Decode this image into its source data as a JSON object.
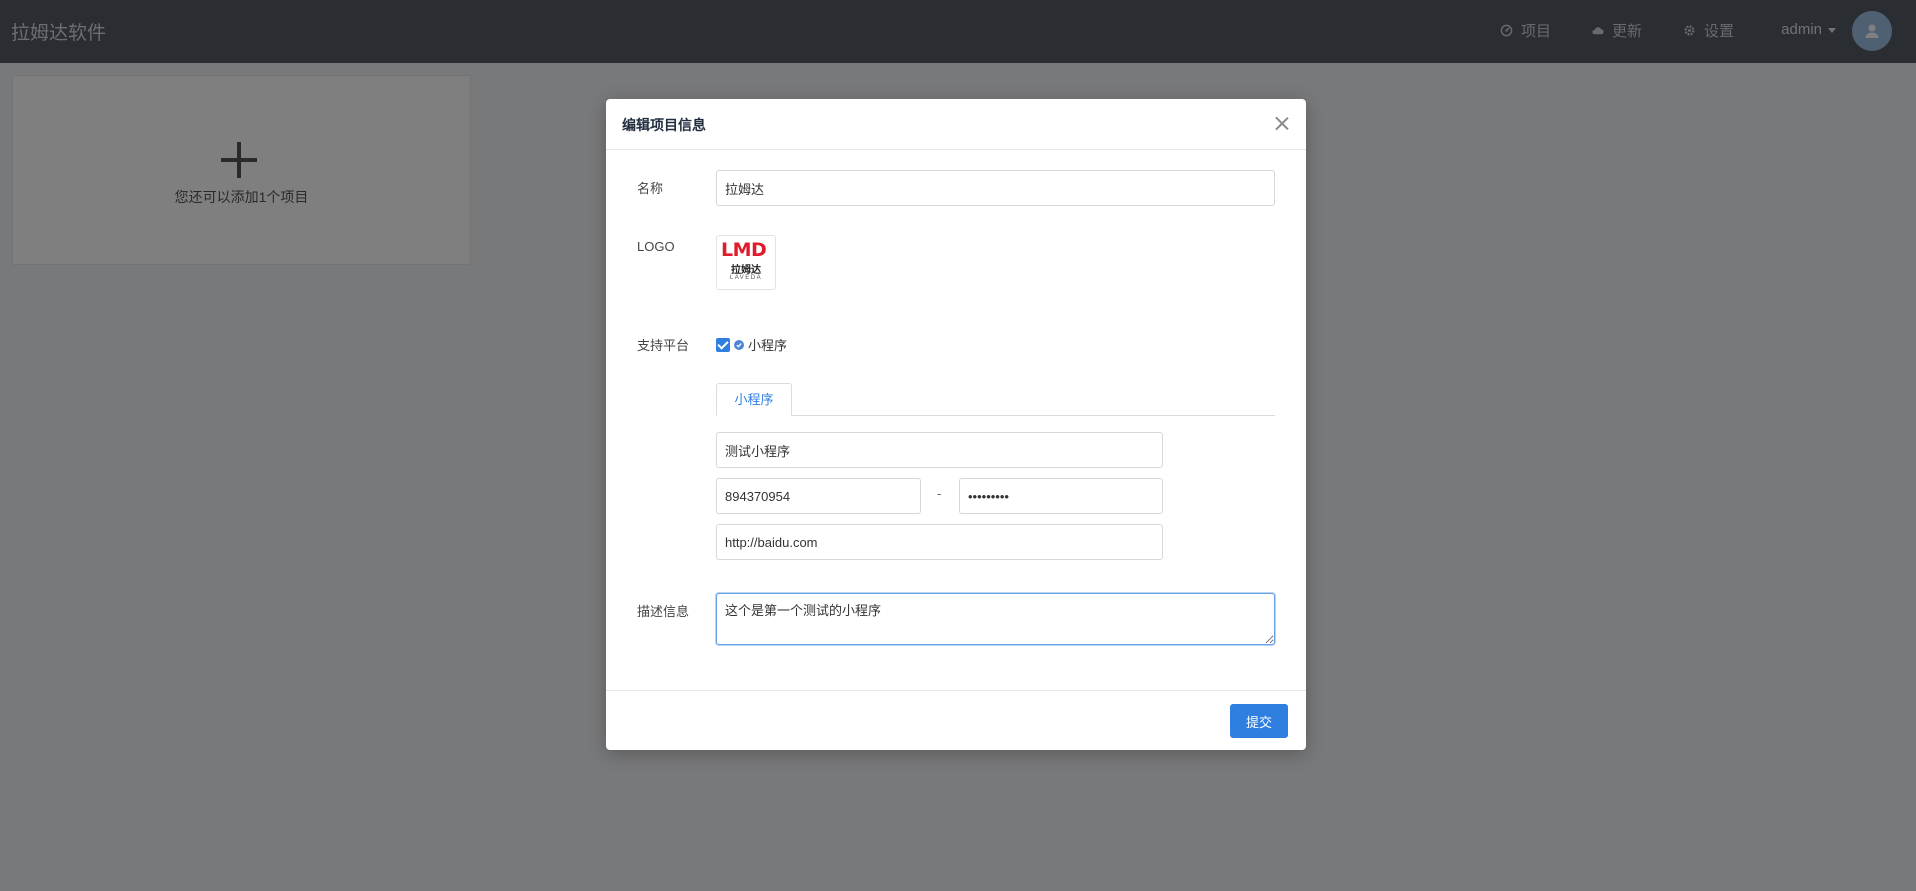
{
  "app": {
    "title": "拉姆达软件"
  },
  "nav": {
    "items": [
      {
        "label": "项目",
        "icon": "dashboard-icon"
      },
      {
        "label": "更新",
        "icon": "cloud-icon"
      },
      {
        "label": "设置",
        "icon": "gear-icon"
      }
    ],
    "user": "admin"
  },
  "page": {
    "add_hint": "您还可以添加1个项目"
  },
  "modal": {
    "title": "编辑项目信息",
    "name_label": "名称",
    "name_value": "拉姆达",
    "logo_label": "LOGO",
    "logo": {
      "mark": "LMD",
      "cn": "拉姆达",
      "en": "LAVEDA"
    },
    "platform_label": "支持平台",
    "platform_option": "小程序",
    "platform_checked": true,
    "tab_label": "小程序",
    "app_name": "测试小程序",
    "app_id": "894370954",
    "separator": "-",
    "app_secret": "•••••••••",
    "app_url": "http://baidu.com",
    "desc_label": "描述信息",
    "desc_value": "这个是第一个测试的小程序",
    "submit_label": "提交"
  },
  "colors": {
    "primary": "#2f7fe0",
    "nav_bg": "#545c64",
    "logo_red": "#e01b2c"
  }
}
